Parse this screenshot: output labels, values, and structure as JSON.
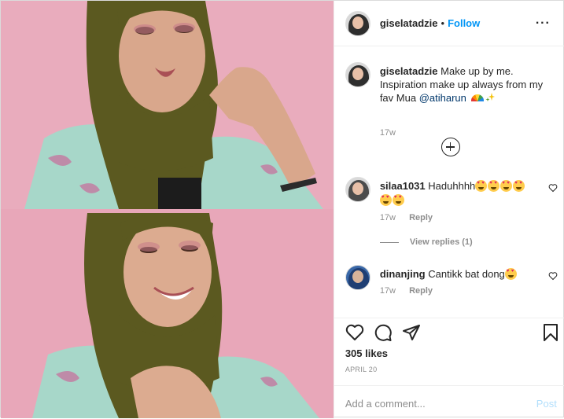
{
  "header": {
    "username": "giselatadzie",
    "separator": "•",
    "follow_label": "Follow",
    "more_label": "···"
  },
  "caption": {
    "username": "giselatadzie",
    "text": "Make up by me. Inspiration make up always from my fav Mua",
    "mention": "@atiharun",
    "time": "17w"
  },
  "comments": [
    {
      "username": "silaa1031",
      "text": "Haduhhhh",
      "emoji_count": 6,
      "time": "17w",
      "reply_label": "Reply",
      "view_replies": "View replies (1)"
    },
    {
      "username": "dinanjing",
      "text": "Cantikk bat dong",
      "emoji_count": 1,
      "time": "17w",
      "reply_label": "Reply"
    }
  ],
  "footer": {
    "likes": "305 likes",
    "date": "APRIL 20",
    "comment_placeholder": "Add a comment...",
    "post_label": "Post"
  },
  "colors": {
    "accent": "#0095f6",
    "background_pink": "#e9a6b8",
    "hijab": "#5c5a1e",
    "shirt": "#a6d8cc"
  },
  "icons": [
    "heart-icon",
    "comment-icon",
    "share-icon",
    "bookmark-icon",
    "add-circle-icon",
    "heart-icon-small"
  ]
}
